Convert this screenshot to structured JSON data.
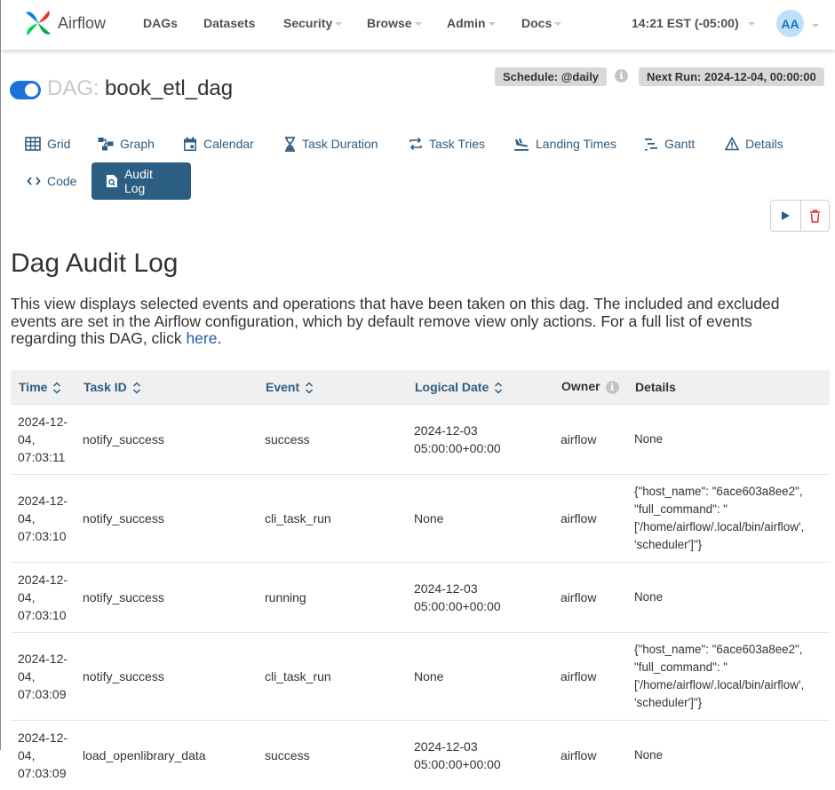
{
  "app": {
    "brand": "Airflow"
  },
  "nav": {
    "items": [
      {
        "label": "DAGs",
        "dropdown": false
      },
      {
        "label": "Datasets",
        "dropdown": false
      },
      {
        "label": "Security",
        "dropdown": true
      },
      {
        "label": "Browse",
        "dropdown": true
      },
      {
        "label": "Admin",
        "dropdown": true
      },
      {
        "label": "Docs",
        "dropdown": true
      }
    ],
    "clock": "14:21 EST (-05:00)",
    "user_initials": "AA"
  },
  "dag": {
    "prefix": "DAG:",
    "id": "book_etl_dag",
    "paused": false,
    "schedule": "Schedule: @daily",
    "next_run": "Next Run: 2024-12-04, 00:00:00"
  },
  "tabs": [
    {
      "label": "Grid",
      "icon": "grid-icon"
    },
    {
      "label": "Graph",
      "icon": "graph-icon"
    },
    {
      "label": "Calendar",
      "icon": "calendar-icon"
    },
    {
      "label": "Task Duration",
      "icon": "hourglass-icon"
    },
    {
      "label": "Task Tries",
      "icon": "retry-icon"
    },
    {
      "label": "Landing Times",
      "icon": "landing-icon"
    },
    {
      "label": "Gantt",
      "icon": "gantt-icon"
    },
    {
      "label": "Details",
      "icon": "warning-triangle-icon"
    },
    {
      "label": "Code",
      "icon": "code-icon"
    },
    {
      "label": "Audit Log",
      "icon": "file-search-icon",
      "active": true
    }
  ],
  "page": {
    "title": "Dag Audit Log",
    "description": "This view displays selected events and operations that have been taken on this dag. The included and excluded events are set in the Airflow configuration, which by default remove view only actions. For a full list of events regarding this DAG, click ",
    "link_text": "here",
    "description_end": "."
  },
  "table": {
    "columns": [
      "Time",
      "Task ID",
      "Event",
      "Logical Date",
      "Owner",
      "Details"
    ],
    "rows": [
      {
        "time": "2024-12-04, 07:03:11",
        "task_id": "notify_success",
        "event": "success",
        "logical_date": "2024-12-03 05:00:00+00:00",
        "owner": "airflow",
        "details": "None"
      },
      {
        "time": "2024-12-04, 07:03:10",
        "task_id": "notify_success",
        "event": "cli_task_run",
        "logical_date": "None",
        "owner": "airflow",
        "details": "{\"host_name\": \"6ace603a8ee2\", \"full_command\": \"['/home/airflow/.local/bin/airflow', 'scheduler']\"}"
      },
      {
        "time": "2024-12-04, 07:03:10",
        "task_id": "notify_success",
        "event": "running",
        "logical_date": "2024-12-03 05:00:00+00:00",
        "owner": "airflow",
        "details": "None"
      },
      {
        "time": "2024-12-04, 07:03:09",
        "task_id": "notify_success",
        "event": "cli_task_run",
        "logical_date": "None",
        "owner": "airflow",
        "details": "{\"host_name\": \"6ace603a8ee2\", \"full_command\": \"['/home/airflow/.local/bin/airflow', 'scheduler']\"}"
      },
      {
        "time": "2024-12-04, 07:03:09",
        "task_id": "load_openlibrary_data",
        "event": "success",
        "logical_date": "2024-12-03 05:00:00+00:00",
        "owner": "airflow",
        "details": "None"
      }
    ]
  }
}
